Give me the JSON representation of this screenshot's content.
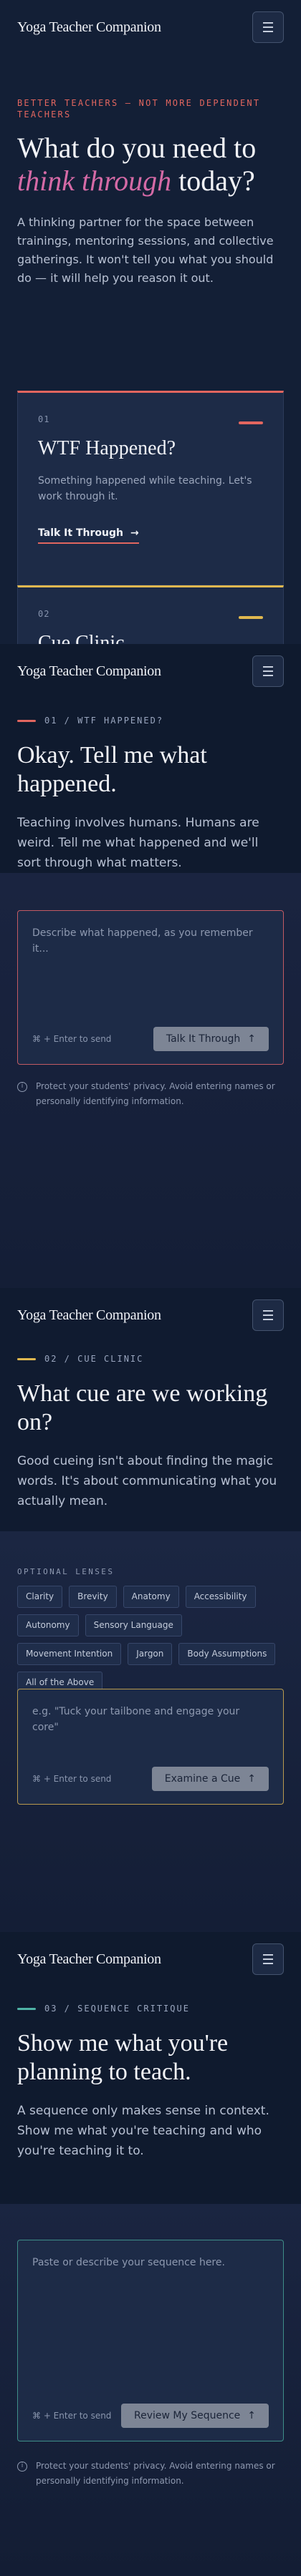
{
  "brand": "Yoga Teacher Companion",
  "hero": {
    "eyebrow": "Better teachers — not more dependent teachers",
    "title_line1": "What do you need to",
    "title_em": "think through",
    "title_tail": " today?",
    "body": "A thinking partner for the space between trainings, mentoring sessions, and collective gatherings. It won't tell you what you should do — it will help you reason it out.",
    "cards": [
      {
        "num": "01",
        "title": "WTF Happened?",
        "desc": "Something happened while teaching. Let's work through it.",
        "cta": "Talk It Through",
        "color": "#e2665f"
      },
      {
        "num": "02",
        "title": "Cue Clinic",
        "color": "#e0b84f"
      }
    ]
  },
  "wtf": {
    "tag": "01 / WTF Happened?",
    "color": "#e2665f",
    "title": "Okay. Tell me what happened.",
    "desc": "Teaching involves humans. Humans are weird. Tell me what happened and we'll sort through what matters.",
    "placeholder": "Describe what happened, as you remember it...",
    "hint": "⌘ + Enter to send",
    "button": "Talk It Through",
    "privacy": "Protect your students' privacy. Avoid entering names or personally identifying information."
  },
  "cue": {
    "tag": "02 / Cue Clinic",
    "color": "#e0b84f",
    "title": "What cue are we working on?",
    "desc": "Good cueing isn't about finding the magic words. It's about communicating what you actually mean.",
    "lenses_label": "Optional Lenses",
    "lenses": [
      "Clarity",
      "Brevity",
      "Anatomy",
      "Accessibility",
      "Autonomy",
      "Sensory Language",
      "Movement Intention",
      "Jargon",
      "Body Assumptions",
      "All of the Above"
    ],
    "placeholder": "e.g. \"Tuck your tailbone and engage your core\"",
    "hint": "⌘ + Enter to send",
    "button": "Examine a Cue"
  },
  "seq": {
    "tag": "03 / Sequence Critique",
    "color": "#4fb3a6",
    "title": "Show me what you're planning to teach.",
    "desc": "A sequence only makes sense in context. Show me what you're teaching and who you're teaching it to.",
    "placeholder": "Paste or describe your sequence here.",
    "hint": "⌘ + Enter to send",
    "button": "Review My Sequence",
    "privacy": "Protect your students' privacy. Avoid entering names or personally identifying information."
  }
}
